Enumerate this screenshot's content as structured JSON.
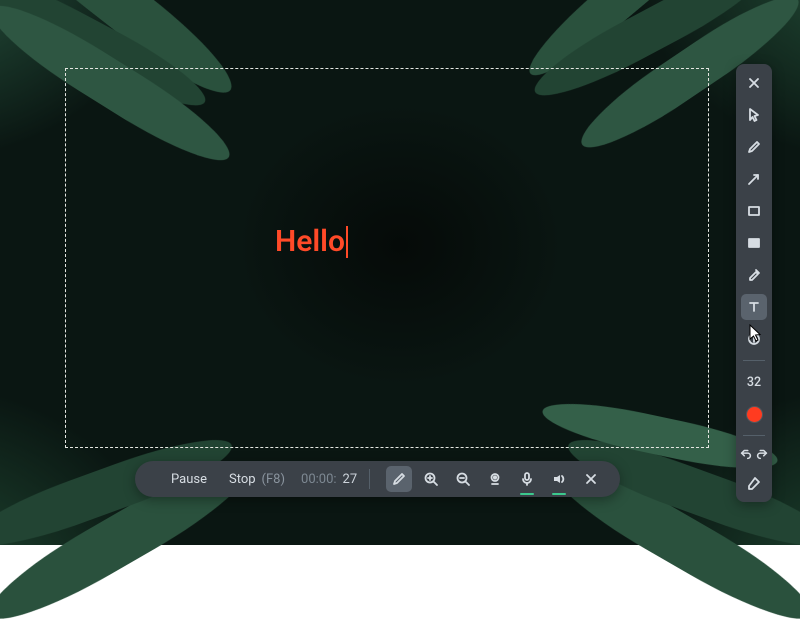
{
  "annotation": {
    "text": "Hello"
  },
  "controls": {
    "pause_label": "Pause",
    "stop_label": "Stop",
    "stop_shortcut": "(F8)",
    "timer_prefix": "00:00:",
    "timer_seconds": "27"
  },
  "sidebar": {
    "font_size": "32"
  },
  "colors": {
    "annotation": "#ff4a28",
    "swatch": "#ff3b20"
  }
}
